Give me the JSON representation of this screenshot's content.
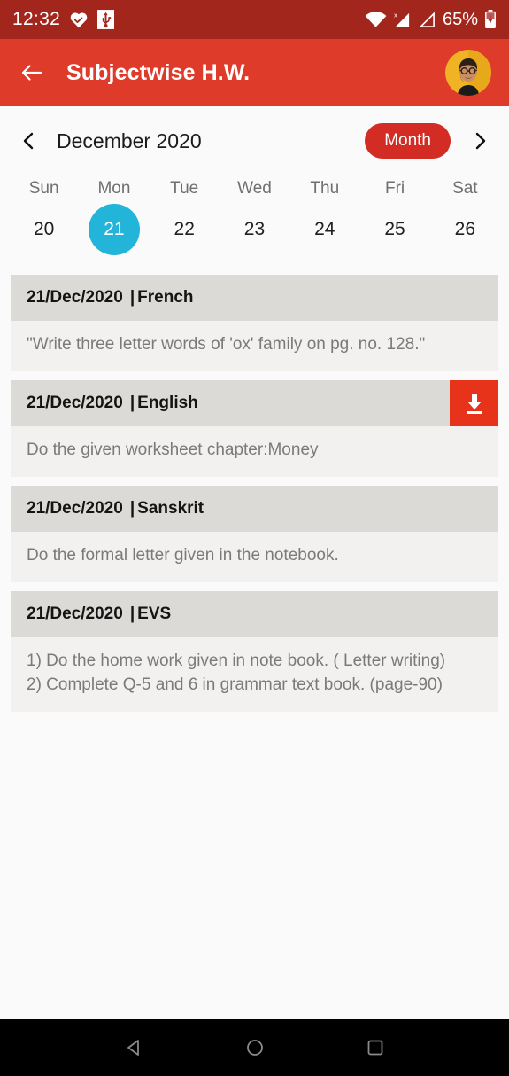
{
  "status_bar": {
    "time": "12:32",
    "battery_percent": "65%",
    "icons": [
      "heart-check-icon",
      "usb-icon",
      "wifi-icon",
      "signal-no-sim-icon",
      "signal-icon",
      "battery-charging-icon"
    ]
  },
  "app_bar": {
    "back_label": "back-arrow-icon",
    "title": "Subjectwise H.W.",
    "avatar_label": "user-avatar"
  },
  "calendar": {
    "month_label": "December 2020",
    "view_button": "Month",
    "prev_label": "previous-month",
    "next_label": "next-month",
    "weekdays": [
      "Sun",
      "Mon",
      "Tue",
      "Wed",
      "Thu",
      "Fri",
      "Sat"
    ],
    "dates": [
      {
        "day": "20",
        "selected": false
      },
      {
        "day": "21",
        "selected": true
      },
      {
        "day": "22",
        "selected": false
      },
      {
        "day": "23",
        "selected": false
      },
      {
        "day": "24",
        "selected": false
      },
      {
        "day": "25",
        "selected": false
      },
      {
        "day": "26",
        "selected": false
      }
    ],
    "selected_color": "#23B5D9"
  },
  "homework": [
    {
      "date": "21/Dec/2020",
      "separator": "|",
      "subject": "French",
      "description": "\"Write three letter words of 'ox' family on pg. no. 128.\"",
      "has_download": false
    },
    {
      "date": "21/Dec/2020",
      "separator": "|",
      "subject": "English",
      "description": "Do the given worksheet chapter:Money",
      "has_download": true
    },
    {
      "date": "21/Dec/2020",
      "separator": "|",
      "subject": "Sanskrit",
      "description": "Do the formal letter given in the notebook.",
      "has_download": false
    },
    {
      "date": "21/Dec/2020",
      "separator": "|",
      "subject": "EVS",
      "description": "1) Do the home work given in note book. ( Letter writing)\n2) Complete Q-5 and 6 in grammar text book. (page-90)",
      "has_download": false
    }
  ],
  "nav_bar": {
    "back": "back-triangle-icon",
    "home": "home-circle-icon",
    "recents": "recents-square-icon"
  },
  "colors": {
    "status_bar": "#A3261D",
    "app_bar": "#DE3B2B",
    "accent_pill": "#D32C24",
    "download_button": "#E8331B",
    "card_header": "#DCDAD6",
    "card_body": "#F2F1EF",
    "page_background": "#FAFAFA"
  }
}
